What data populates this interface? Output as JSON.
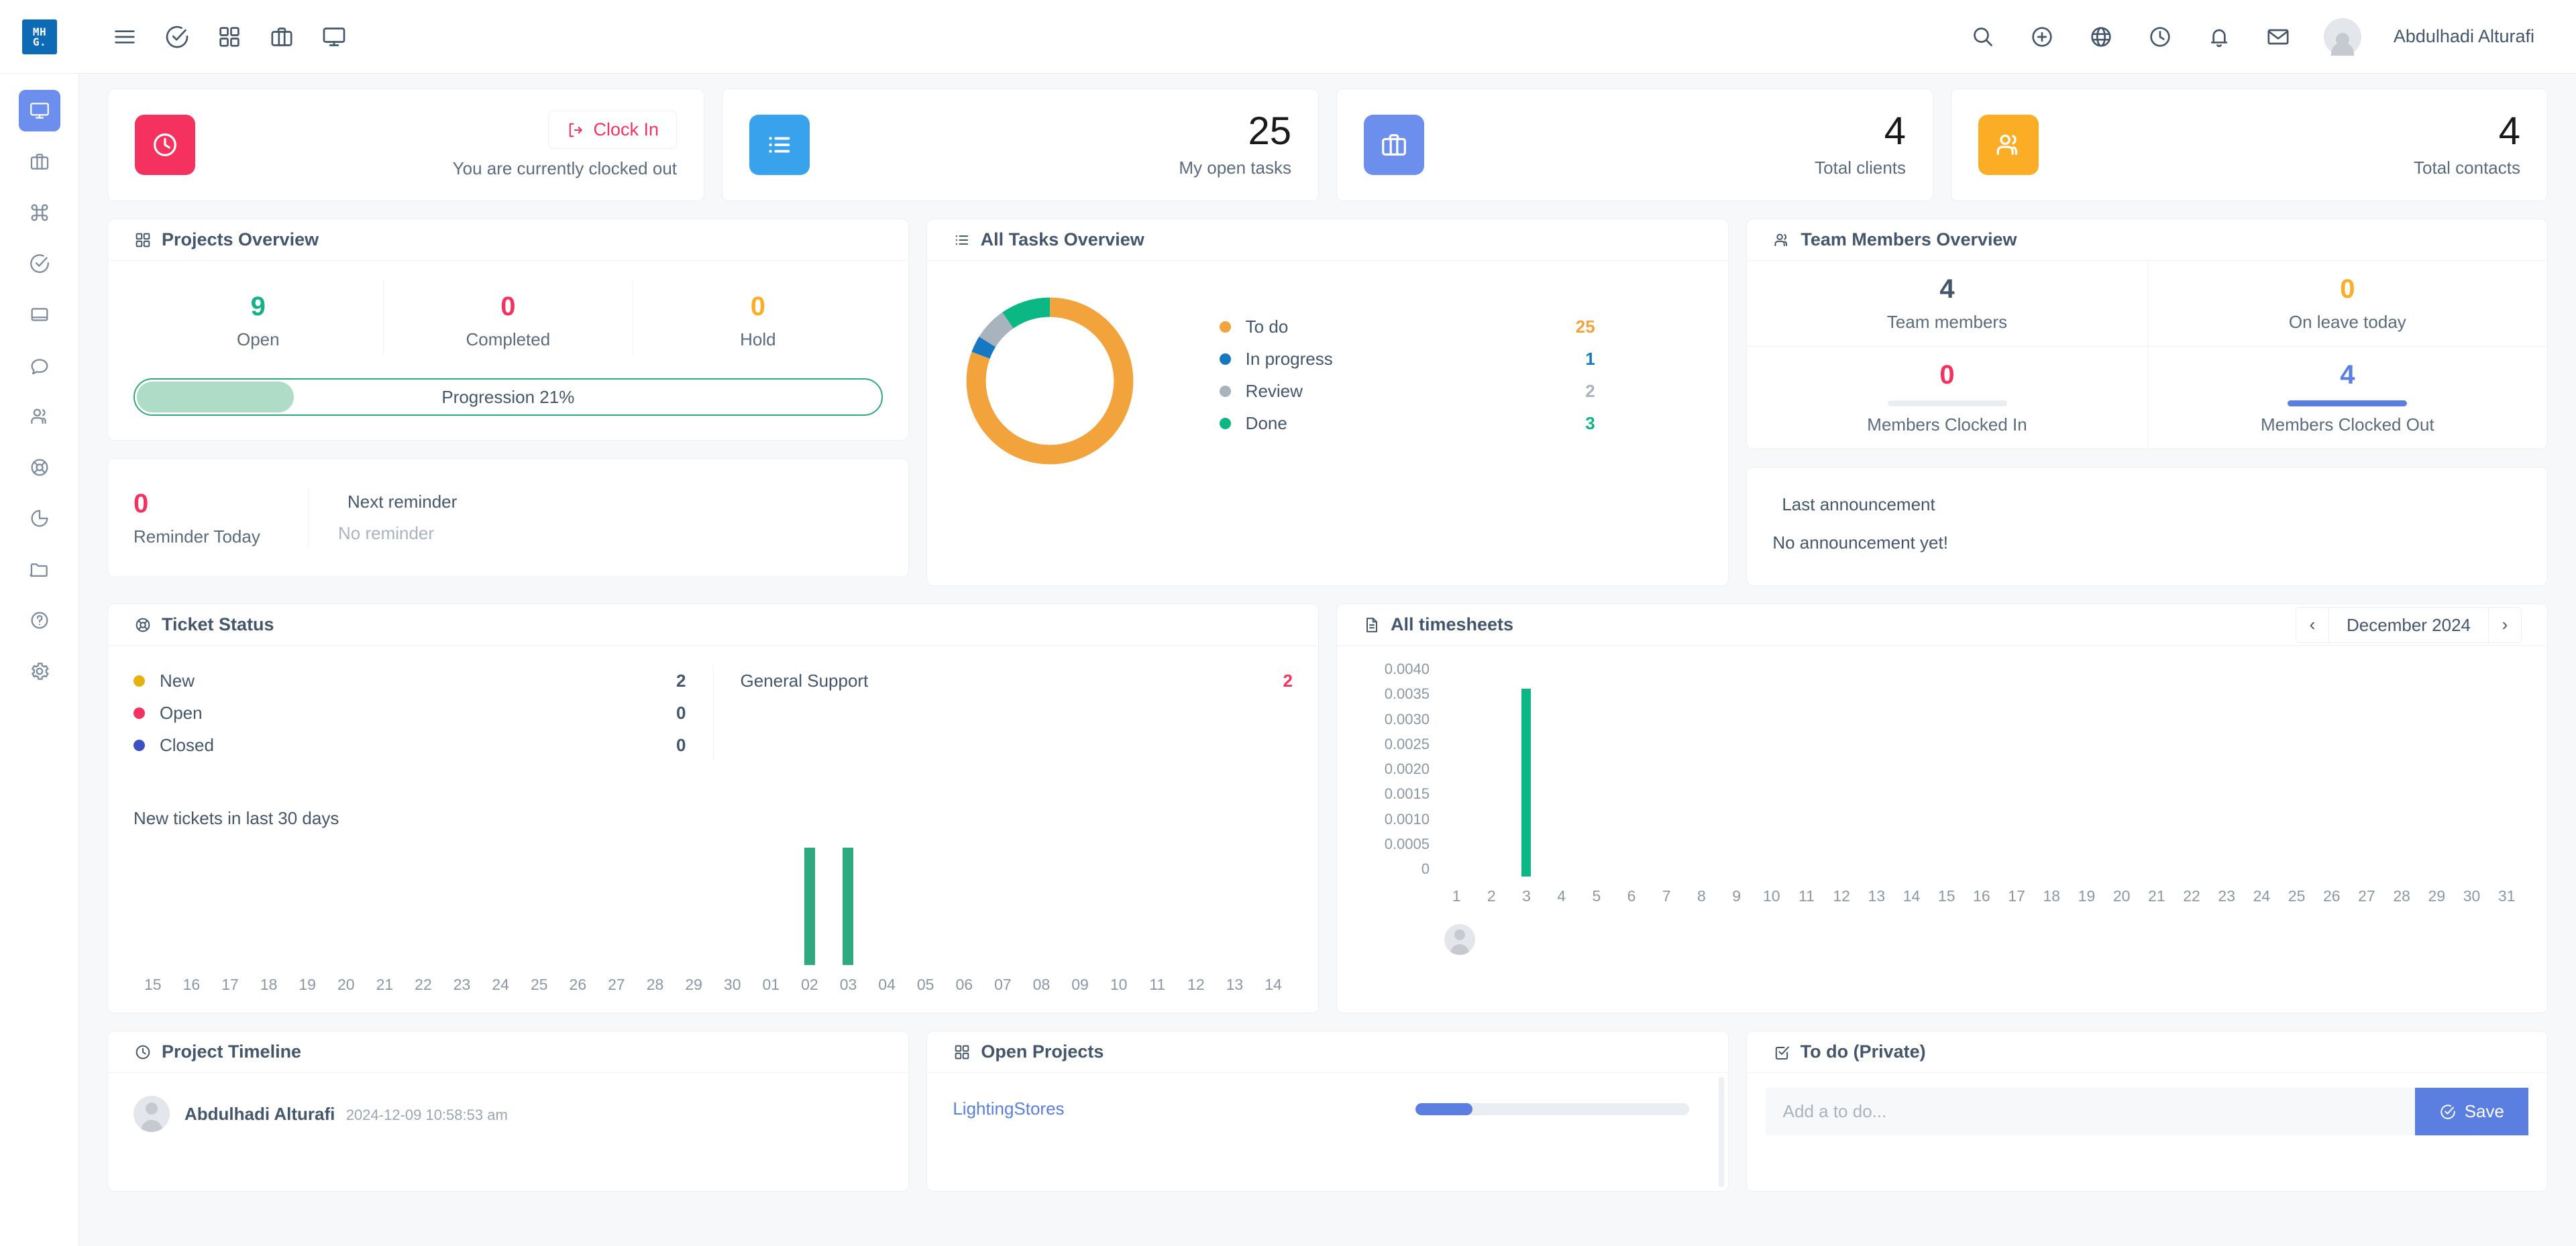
{
  "brand": {
    "logo_text_line1": "MH",
    "logo_text_line2": "G."
  },
  "topbar": {
    "icons": [
      "menu-icon",
      "task-check-icon",
      "grid-icon",
      "briefcase-icon",
      "monitor-icon"
    ],
    "right_icons": [
      "search-icon",
      "plus-circle-icon",
      "globe-icon",
      "clock-icon",
      "bell-icon",
      "mail-icon"
    ],
    "user_name": "Abdulhadi Alturafi"
  },
  "sidebar": {
    "items": [
      {
        "name": "dashboard",
        "icon": "monitor-icon",
        "active": true
      },
      {
        "name": "projects",
        "icon": "briefcase-icon",
        "active": false
      },
      {
        "name": "command",
        "icon": "command-icon",
        "active": false
      },
      {
        "name": "tasks",
        "icon": "task-check-icon",
        "active": false
      },
      {
        "name": "notes",
        "icon": "book-icon",
        "active": false
      },
      {
        "name": "messages",
        "icon": "chat-icon",
        "active": false
      },
      {
        "name": "team",
        "icon": "users-icon",
        "active": false
      },
      {
        "name": "support",
        "icon": "lifebuoy-icon",
        "active": false
      },
      {
        "name": "reports",
        "icon": "pie-chart-icon",
        "active": false
      },
      {
        "name": "files",
        "icon": "folder-icon",
        "active": false
      },
      {
        "name": "help",
        "icon": "question-circle-icon",
        "active": false
      },
      {
        "name": "settings",
        "icon": "gear-icon",
        "active": false
      }
    ]
  },
  "stats": {
    "clock": {
      "icon": "clock-icon",
      "icon_color": "#f5325f",
      "button_label": "Clock In",
      "status_text": "You are currently clocked out"
    },
    "tasks": {
      "icon": "list-icon",
      "icon_color": "#38a3ec",
      "value": "25",
      "label": "My open tasks"
    },
    "clients": {
      "icon": "briefcase-icon",
      "icon_color": "#6c8fee",
      "value": "4",
      "label": "Total clients"
    },
    "contacts": {
      "icon": "users-icon",
      "icon_color": "#fcad26",
      "value": "4",
      "label": "Total contacts"
    }
  },
  "projects_overview": {
    "title": "Projects Overview",
    "icon": "grid-icon",
    "metrics": [
      {
        "value": "9",
        "label": "Open",
        "color": "#16b187"
      },
      {
        "value": "0",
        "label": "Completed",
        "color": "#f5325f"
      },
      {
        "value": "0",
        "label": "Hold",
        "color": "#fcad26"
      }
    ],
    "progression_label": "Progression 21%",
    "progression_percent": 21,
    "progression_color": "#2eaa7f"
  },
  "reminder": {
    "count": "0",
    "count_label": "Reminder Today",
    "next_label": "Next reminder",
    "next_icon": "bell-icon",
    "next_value": "No reminder"
  },
  "all_tasks_overview": {
    "title": "All Tasks Overview",
    "icon": "list-icon"
  },
  "team_members_overview": {
    "title": "Team Members Overview",
    "icon": "users-icon",
    "metrics": [
      {
        "value": "4",
        "label": "Team members",
        "color": "#44566c",
        "bar": null
      },
      {
        "value": "0",
        "label": "On leave today",
        "color": "#fcad26",
        "bar": null
      },
      {
        "value": "0",
        "label": "Members Clocked In",
        "color": "#f5325f",
        "bar": 0,
        "bar_color": "#eaedf1"
      },
      {
        "value": "4",
        "label": "Members Clocked Out",
        "color": "#5a7fe0",
        "bar": 100,
        "bar_color": "#5a7fe0"
      }
    ]
  },
  "announcement": {
    "icon": "microphone-icon",
    "title": "Last announcement",
    "body": "No announcement yet!"
  },
  "ticket_status": {
    "title": "Ticket Status",
    "icon": "lifebuoy-icon",
    "statuses": [
      {
        "label": "New",
        "value": "2",
        "color": "#e8b20e"
      },
      {
        "label": "Open",
        "value": "0",
        "color": "#f5325f"
      },
      {
        "label": "Closed",
        "value": "0",
        "color": "#3d4fc5"
      }
    ],
    "categories": [
      {
        "label": "General Support",
        "value": "2",
        "value_color": "#f5325f"
      }
    ],
    "chart_label": "New tickets in last 30 days"
  },
  "timesheets": {
    "title": "All timesheets",
    "icon": "document-icon",
    "month": "December 2024",
    "prev_label": "‹",
    "next_label": "›"
  },
  "project_timeline": {
    "title": "Project Timeline",
    "icon": "clock-icon",
    "entries": [
      {
        "name": "Abdulhadi Alturafi",
        "time": "2024-12-09 10:58:53 am"
      }
    ]
  },
  "open_projects": {
    "title": "Open Projects",
    "icon": "grid-icon",
    "projects": [
      {
        "name": "LightingStores",
        "progress": 21
      }
    ]
  },
  "todo": {
    "title": "To do (Private)",
    "icon": "checkbox-icon",
    "placeholder": "Add a to do...",
    "value": "",
    "save_label": "Save",
    "save_icon": "check-circle-icon"
  },
  "chart_data": [
    {
      "type": "pie",
      "title": "All Tasks Overview",
      "legend_position": "right",
      "labels": [
        "To do",
        "In progress",
        "Review",
        "Done"
      ],
      "values": [
        25,
        1,
        2,
        3
      ],
      "colors": [
        "#f2a33c",
        "#1678c2",
        "#a8b3bd",
        "#0bb783"
      ]
    },
    {
      "type": "bar",
      "title": "New tickets in last 30 days",
      "xlabel": "",
      "ylabel": "",
      "grid": false,
      "categories": [
        "15",
        "16",
        "17",
        "18",
        "19",
        "20",
        "21",
        "22",
        "23",
        "24",
        "25",
        "26",
        "27",
        "28",
        "29",
        "30",
        "01",
        "02",
        "03",
        "04",
        "05",
        "06",
        "07",
        "08",
        "09",
        "10",
        "11",
        "12",
        "13",
        "14"
      ],
      "values": [
        0,
        0,
        0,
        0,
        0,
        0,
        0,
        0,
        0,
        0,
        0,
        0,
        0,
        0,
        0,
        0,
        0,
        1,
        1,
        0,
        0,
        0,
        0,
        0,
        0,
        0,
        0,
        0,
        0,
        0
      ],
      "ylim": [
        0,
        1
      ],
      "bar_color": "#2eaa7f"
    },
    {
      "type": "bar",
      "title": "All timesheets",
      "subtitle": "December 2024",
      "xlabel": "",
      "ylabel": "",
      "grid": false,
      "categories": [
        "1",
        "2",
        "3",
        "4",
        "5",
        "6",
        "7",
        "8",
        "9",
        "10",
        "11",
        "12",
        "13",
        "14",
        "15",
        "16",
        "17",
        "18",
        "19",
        "20",
        "21",
        "22",
        "23",
        "24",
        "25",
        "26",
        "27",
        "28",
        "29",
        "30",
        "31"
      ],
      "values": [
        0,
        0,
        0.0035,
        0,
        0,
        0,
        0,
        0,
        0,
        0,
        0,
        0,
        0,
        0,
        0,
        0,
        0,
        0,
        0,
        0,
        0,
        0,
        0,
        0,
        0,
        0,
        0,
        0,
        0,
        0,
        0
      ],
      "ytick_labels": [
        "0.0040",
        "0.0035",
        "0.0030",
        "0.0025",
        "0.0020",
        "0.0015",
        "0.0010",
        "0.0005",
        "0"
      ],
      "ylim": [
        0,
        0.004
      ],
      "bar_color": "#0bb783"
    }
  ]
}
